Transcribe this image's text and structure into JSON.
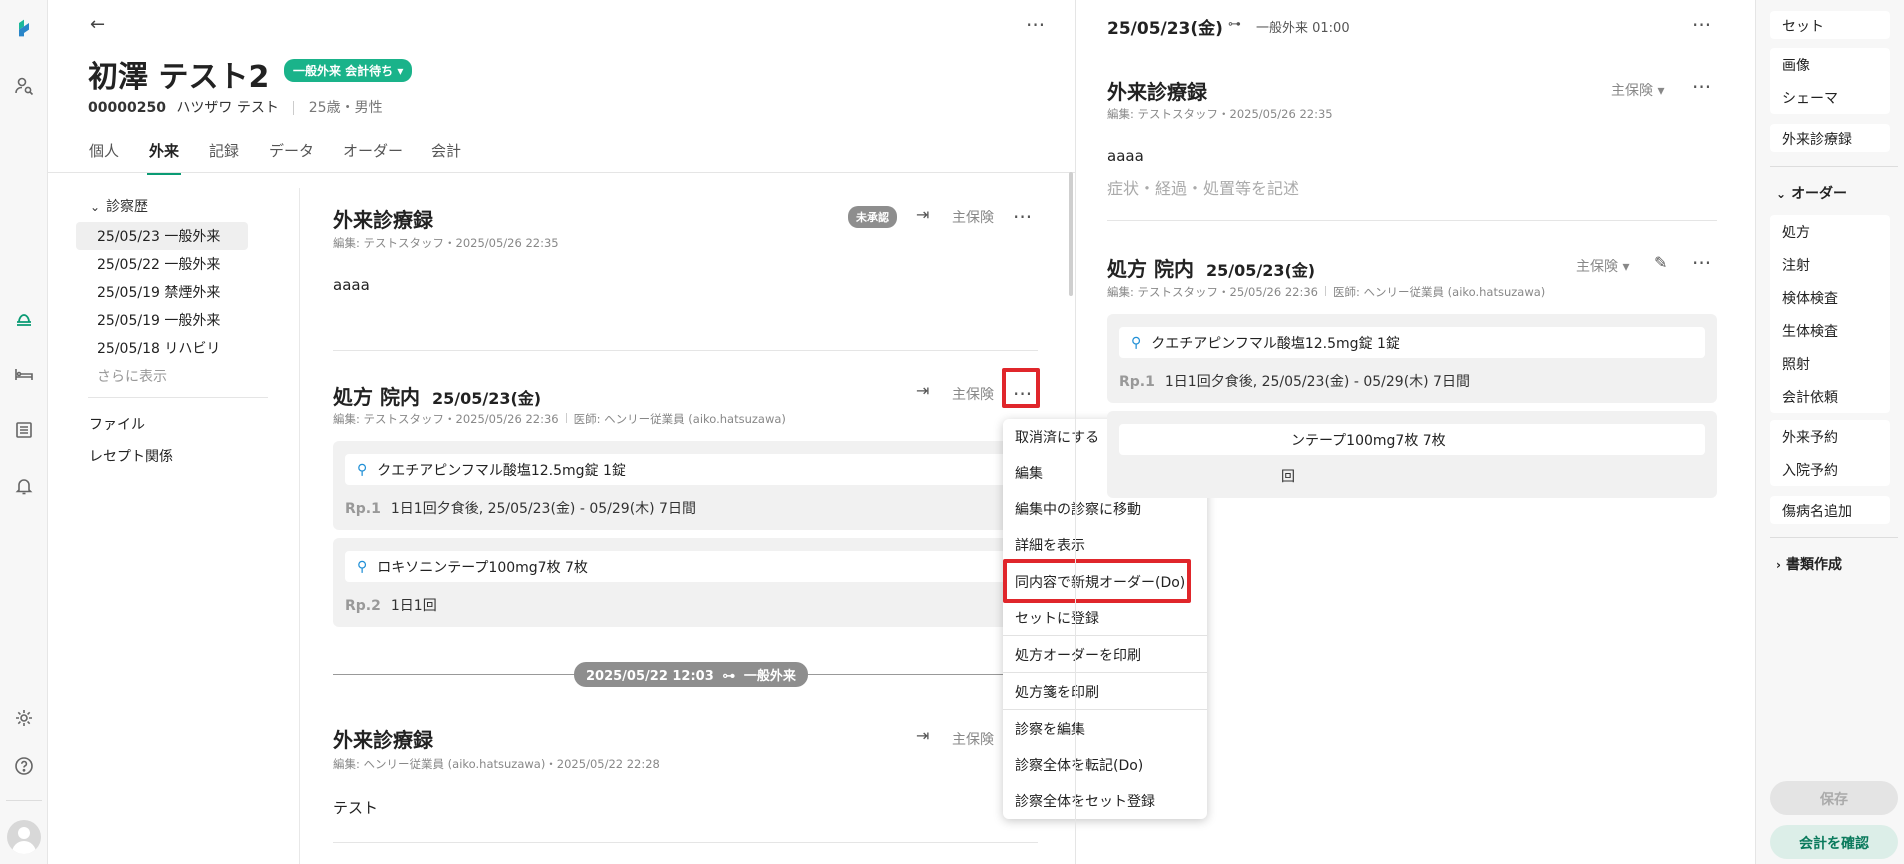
{
  "nav": {
    "icons": [
      "app-logo",
      "patient-search-icon",
      "outpatient-icon",
      "bed-icon",
      "list-icon",
      "bell-icon",
      "settings-icon",
      "help-icon",
      "user-avatar"
    ]
  },
  "patient": {
    "name": "初澤 テスト2",
    "status": "一般外来 会計待ち",
    "id": "00000250",
    "kana": "ハツザワ テスト",
    "age_sex": "25歳・男性"
  },
  "tabs": [
    "個人",
    "外来",
    "記録",
    "データ",
    "オーダー",
    "会計"
  ],
  "history": {
    "title": "診察歴",
    "items": [
      "25/05/23 一般外来",
      "25/05/22 一般外来",
      "25/05/19 禁煙外来",
      "25/05/19 一般外来",
      "25/05/18 リハビリ"
    ],
    "more": "さらに表示",
    "links": [
      "ファイル",
      "レセプト関係"
    ]
  },
  "record1": {
    "title": "外来診療録",
    "badge": "未承認",
    "insurance": "主保険",
    "meta": "編集: テストスタッフ・2025/05/26 22:35",
    "body": "aaaa"
  },
  "rx1": {
    "title": "処方 院内",
    "date": "25/05/23(金)",
    "insurance": "主保険",
    "meta": "編集: テストスタッフ・2025/05/26 22:36",
    "doctor": "医師: ヘンリー従業員 (aiko.hatsuzawa)",
    "groups": [
      {
        "drug": "クエチアピンフマル酸塩12.5mg錠  1錠",
        "rp": "Rp.1",
        "usage": "1日1回夕食後, 25/05/23(金) - 05/29(木) 7日間"
      },
      {
        "drug": "ロキソニンテープ100mg7枚  7枚",
        "rp": "Rp.2",
        "usage": "1日1回"
      }
    ]
  },
  "timeline": {
    "label": "2025/05/22 12:03",
    "type": "一般外来"
  },
  "record2": {
    "title": "外来診療録",
    "insurance": "主保険",
    "meta": "編集: ヘンリー従業員 (aiko.hatsuzawa)・2025/05/22 22:28",
    "body": "テスト"
  },
  "menu": {
    "items": [
      "取消済にする",
      "編集",
      "編集中の診察に移動",
      "詳細を表示",
      "同内容で新規オーダー(Do)",
      "セットに登録",
      "処方オーダーを印刷",
      "処方箋を印刷",
      "診察を編集",
      "診察全体を転記(Do)",
      "診察全体をセット登録"
    ]
  },
  "right": {
    "date": "25/05/23(金)",
    "visit": "一般外来 01:00",
    "record_title": "外来診療録",
    "record_insurance": "主保険",
    "record_meta": "編集: テストスタッフ・2025/05/26 22:35",
    "record_body": "aaaa",
    "record_placeholder": "症状・経過・処置等を記述",
    "rx_title": "処方 院内",
    "rx_date": "25/05/23(金)",
    "rx_insurance": "主保険",
    "rx_meta": "編集: テストスタッフ・25/05/26 22:36",
    "rx_doctor": "医師: ヘンリー従業員 (aiko.hatsuzawa)",
    "rx_drug1": "クエチアピンフマル酸塩12.5mg錠  1錠",
    "rx_rp1": "Rp.1",
    "rx_usage1": "1日1回夕食後, 25/05/23(金) - 05/29(木) 7日間",
    "rx_drug2_visible": "ンテープ100mg7枚  7枚",
    "rx_usage2_visible": "回"
  },
  "tools": {
    "set": "セット",
    "group1": [
      "画像",
      "シェーマ"
    ],
    "record": "外来診療録",
    "order_header": "オーダー",
    "group2": [
      "処方",
      "注射",
      "検体検査",
      "生体検査",
      "照射",
      "会計依頼"
    ],
    "group3": [
      "外来予約",
      "入院予約"
    ],
    "disease": "傷病名追加",
    "docs": "書類作成",
    "save": "保存",
    "confirm": "会計を確認"
  },
  "colors": {
    "accent": "#0a9b74",
    "status": "#1ab38a",
    "highlight": "#e0262b"
  }
}
